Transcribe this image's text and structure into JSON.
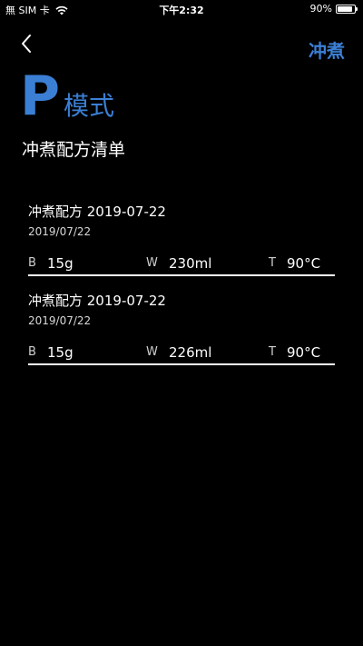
{
  "status_bar": {
    "carrier": "無 SIM 卡",
    "time": "下午2:32",
    "battery_percent_text": "90%",
    "battery_level": 0.9
  },
  "nav": {
    "back_icon": "chevron-left-icon",
    "action_label": "冲煮"
  },
  "header": {
    "mode_letter": "P",
    "mode_label": "模式",
    "list_title": "冲煮配方清单"
  },
  "recipes": [
    {
      "name": "冲煮配方 2019-07-22",
      "date": "2019/07/22",
      "b_key": "B",
      "b_val": "15g",
      "w_key": "W",
      "w_val": "230ml",
      "t_key": "T",
      "t_val": "90°C"
    },
    {
      "name": "冲煮配方 2019-07-22",
      "date": "2019/07/22",
      "b_key": "B",
      "b_val": "15g",
      "w_key": "W",
      "w_val": "226ml",
      "t_key": "T",
      "t_val": "90°C"
    }
  ],
  "colors": {
    "accent": "#3b7fd4",
    "background": "#000000"
  }
}
